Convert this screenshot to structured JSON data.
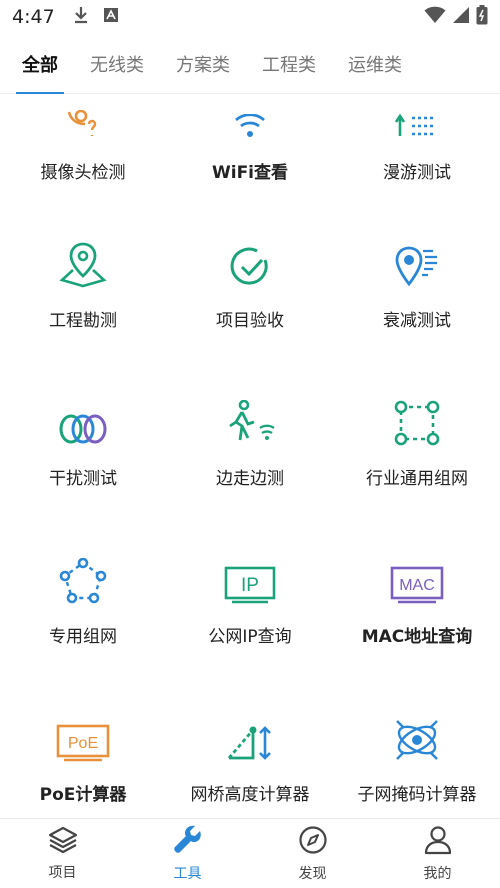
{
  "status_bar": {
    "time": "4:47"
  },
  "tabs": [
    {
      "label": "全部",
      "active": true
    },
    {
      "label": "无线类"
    },
    {
      "label": "方案类"
    },
    {
      "label": "工程类"
    },
    {
      "label": "运维类"
    }
  ],
  "tools": [
    {
      "label": "摄像头检测",
      "icon": "camera-detect-icon"
    },
    {
      "label": "WiFi查看",
      "icon": "wifi-icon"
    },
    {
      "label": "漫游测试",
      "icon": "roaming-icon"
    },
    {
      "label": "工程勘测",
      "icon": "survey-pin-icon"
    },
    {
      "label": "项目验收",
      "icon": "check-circle-icon"
    },
    {
      "label": "衰减测试",
      "icon": "attenuation-pin-icon"
    },
    {
      "label": "干扰测试",
      "icon": "interference-rings-icon"
    },
    {
      "label": "边走边测",
      "icon": "walking-signal-icon"
    },
    {
      "label": "行业通用组网",
      "icon": "square-network-icon"
    },
    {
      "label": "专用组网",
      "icon": "pentagon-network-icon"
    },
    {
      "label": "公网IP查询",
      "icon": "ip-box-icon",
      "icon_text": "IP"
    },
    {
      "label": "MAC地址查询",
      "icon": "mac-box-icon",
      "icon_text": "MAC"
    },
    {
      "label": "PoE计算器",
      "icon": "poe-box-icon",
      "icon_text": "PoE"
    },
    {
      "label": "网桥高度计算器",
      "icon": "bridge-height-icon"
    },
    {
      "label": "子网掩码计算器",
      "icon": "subnet-mask-icon"
    }
  ],
  "bottom_nav": [
    {
      "label": "项目",
      "icon": "layers-icon"
    },
    {
      "label": "工具",
      "icon": "wrench-icon",
      "active": true
    },
    {
      "label": "发现",
      "icon": "compass-icon"
    },
    {
      "label": "我的",
      "icon": "user-icon"
    }
  ],
  "colors": {
    "accent_blue": "#2a87d8",
    "teal": "#1aa37a",
    "orange": "#e8913a",
    "purple": "#7a5fc0"
  }
}
